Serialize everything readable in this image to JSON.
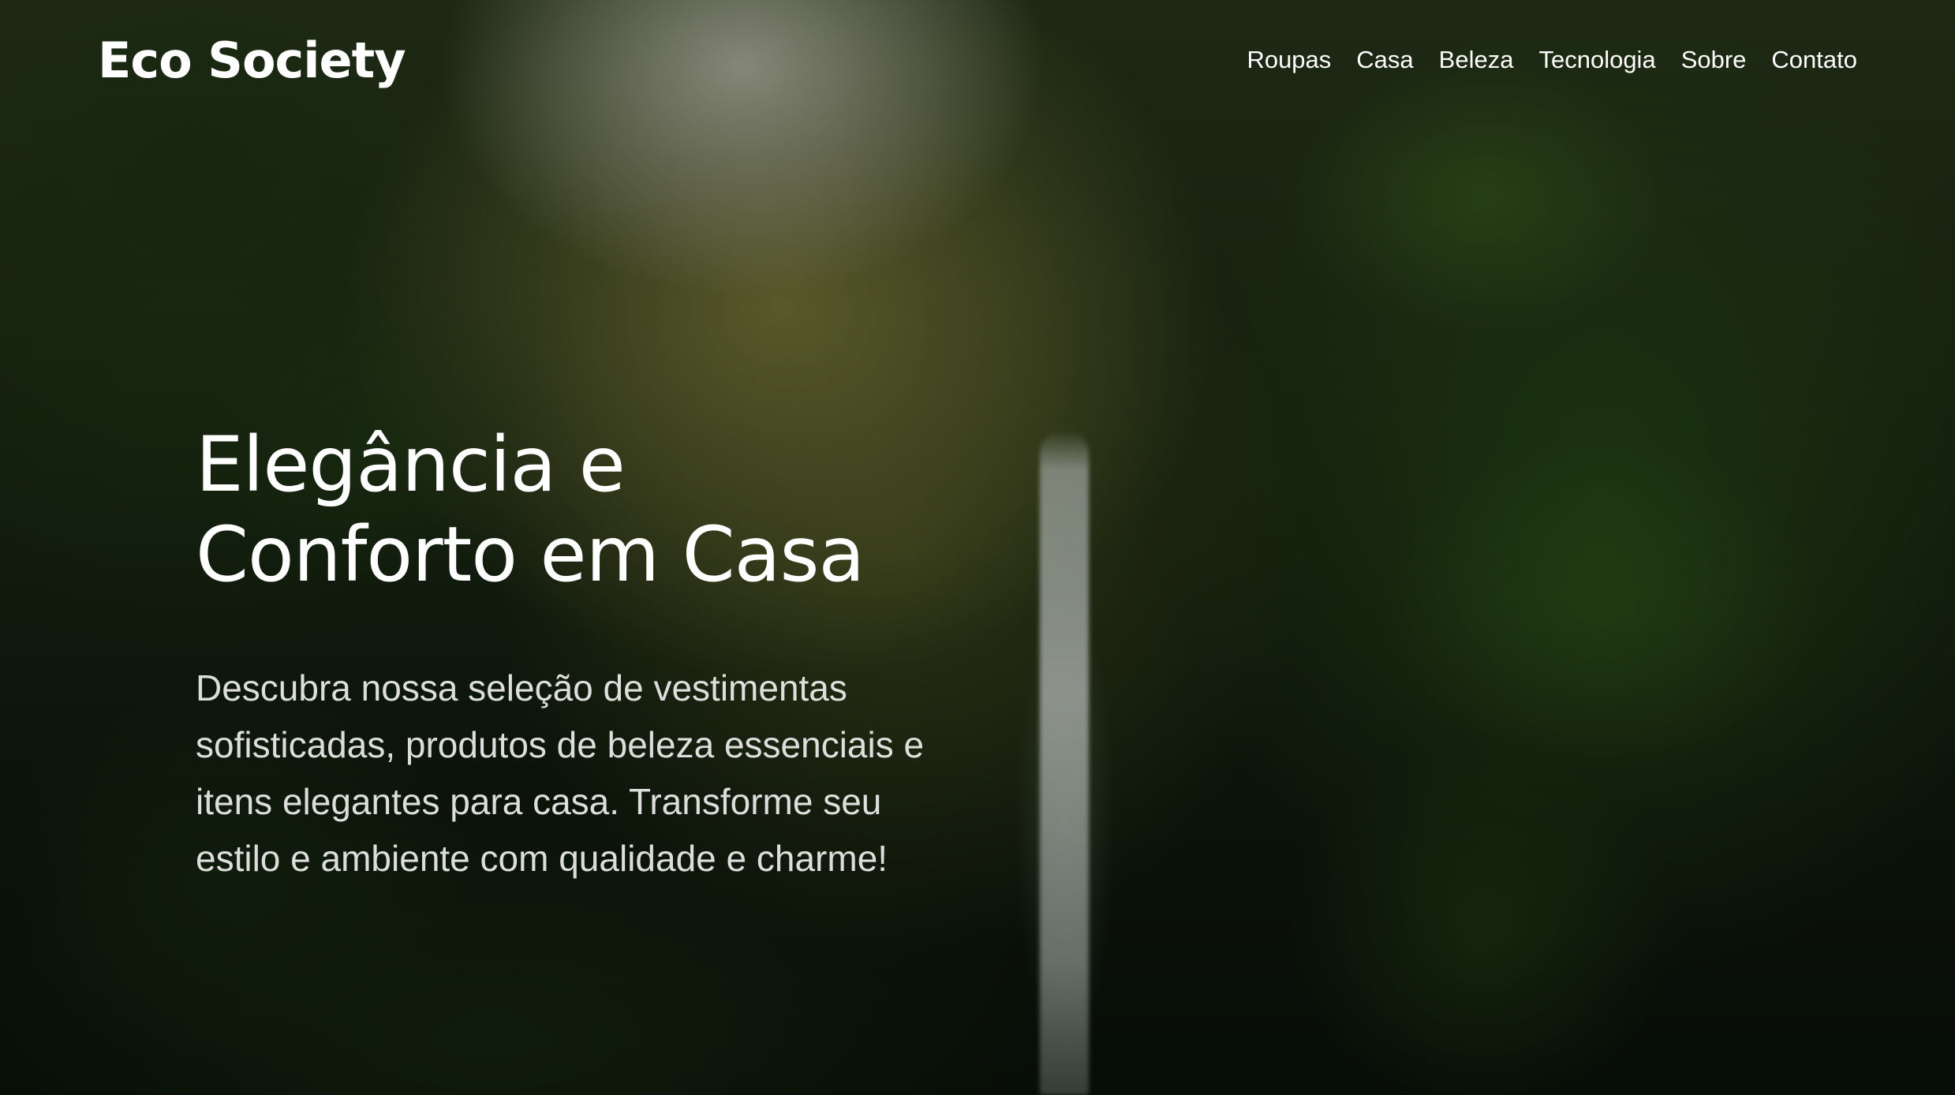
{
  "brand": {
    "name": "Eco Society"
  },
  "nav": {
    "items": [
      {
        "label": "Roupas"
      },
      {
        "label": "Casa"
      },
      {
        "label": "Beleza"
      },
      {
        "label": "Tecnologia"
      },
      {
        "label": "Sobre"
      },
      {
        "label": "Contato"
      }
    ]
  },
  "hero": {
    "title_line1": "Elegância e",
    "title_line2": "Conforto em Casa",
    "description": "Descubra nossa seleção de vestimentas sofisticadas, produtos de beleza essenciais e itens elegantes para casa. Transforme seu estilo e ambiente com qualidade e charme!"
  },
  "colors": {
    "text": "#ffffff",
    "background_dark": "#0b140c",
    "foliage_green": "#2a3a1c"
  }
}
